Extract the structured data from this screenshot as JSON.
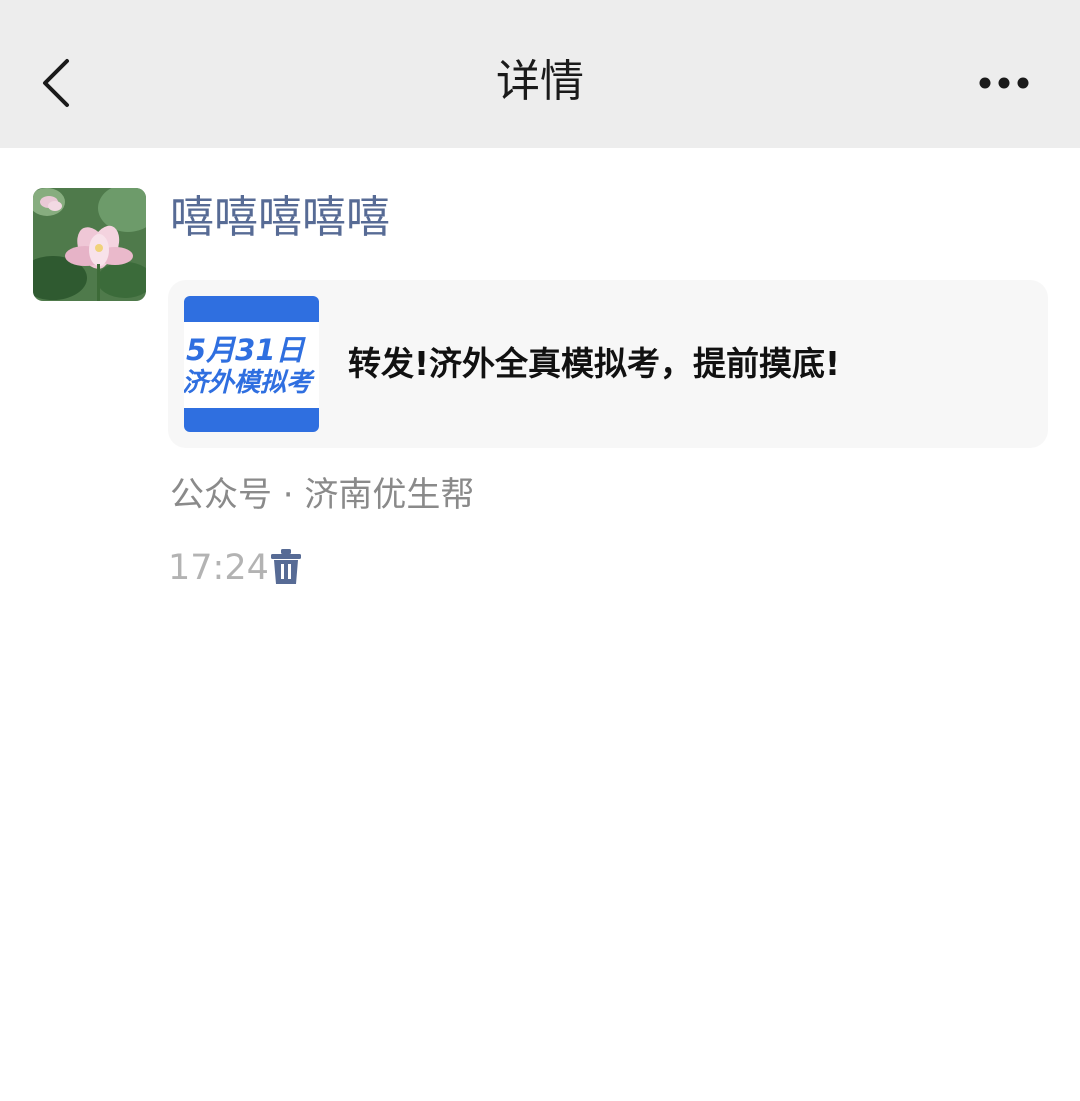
{
  "header": {
    "title": "详情",
    "back_icon": "chevron-left-icon",
    "more_icon": "more-dots-icon"
  },
  "moment": {
    "author": "嘻嘻嘻嘻嘻",
    "avatar_icon": "lotus-avatar",
    "card": {
      "title": "转发!济外全真模拟考，提前摸底!",
      "thumb_line1": "5月31日",
      "thumb_line2": "济外模拟考"
    },
    "source": "公众号 · 济南优生帮",
    "time": "17:24",
    "delete_icon": "trash-icon"
  },
  "colors": {
    "header_bg": "#ededed",
    "name_link": "#576b95",
    "card_bg": "#f7f7f7",
    "thumb_blue": "#2f6fe0"
  }
}
